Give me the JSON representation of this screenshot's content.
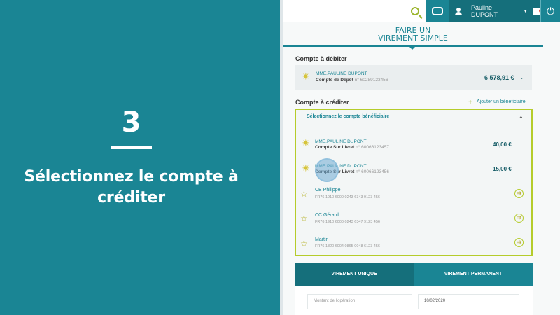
{
  "left": {
    "step_number": "3",
    "instruction_line1": "Sélectionnez le compte à",
    "instruction_line2": "créditer"
  },
  "topbar": {
    "search_icon": "search-icon",
    "chat_icon": "chat-icon",
    "user_name": "Pauline DUPONT",
    "power_icon": "power-icon"
  },
  "page": {
    "title_line1": "FAIRE UN",
    "title_line2": "VIREMENT SIMPLE"
  },
  "debit": {
    "label": "Compte à débiter",
    "account_name": "MME.PAULINE DUPONT",
    "account_type": "Compte de Dépôt",
    "account_num": "n° 60289123456",
    "balance": "6 578,91 €"
  },
  "credit": {
    "label": "Compte à créditer",
    "add_link": "Ajouter un bénéficiaire",
    "select_header": "Sélectionnez le compte bénéficiaire",
    "own_accounts": [
      {
        "name": "MME.PAULINE DUPONT",
        "type": "Compte Sur Livret",
        "num": "n° 60066123457",
        "balance": "40,00 €"
      },
      {
        "name": "MME.PAULINE DUPONT",
        "type": "Compte Sur Livret",
        "num": "n° 60066123456",
        "balance": "15,00 €"
      }
    ],
    "beneficiaries": [
      {
        "name": "CB Philippe",
        "iban": "FR76 1910 6000 0243 6343 9123 456"
      },
      {
        "name": "CC Gérard",
        "iban": "FR76 1910 6000 0243 6347 9123 456"
      },
      {
        "name": "Martin",
        "iban": "FR76 1820 6004 0865 0048 6123 456"
      }
    ]
  },
  "tabs": {
    "unique": "VIREMENT UNIQUE",
    "permanent": "VIREMENT PERMANENT"
  },
  "form": {
    "amount_placeholder": "Montant de l'opération",
    "date_value": "10/02/2020"
  },
  "colors": {
    "teal": "#1a8594",
    "teal_dark": "#156f7b",
    "accent_green": "#b5cc2b"
  }
}
